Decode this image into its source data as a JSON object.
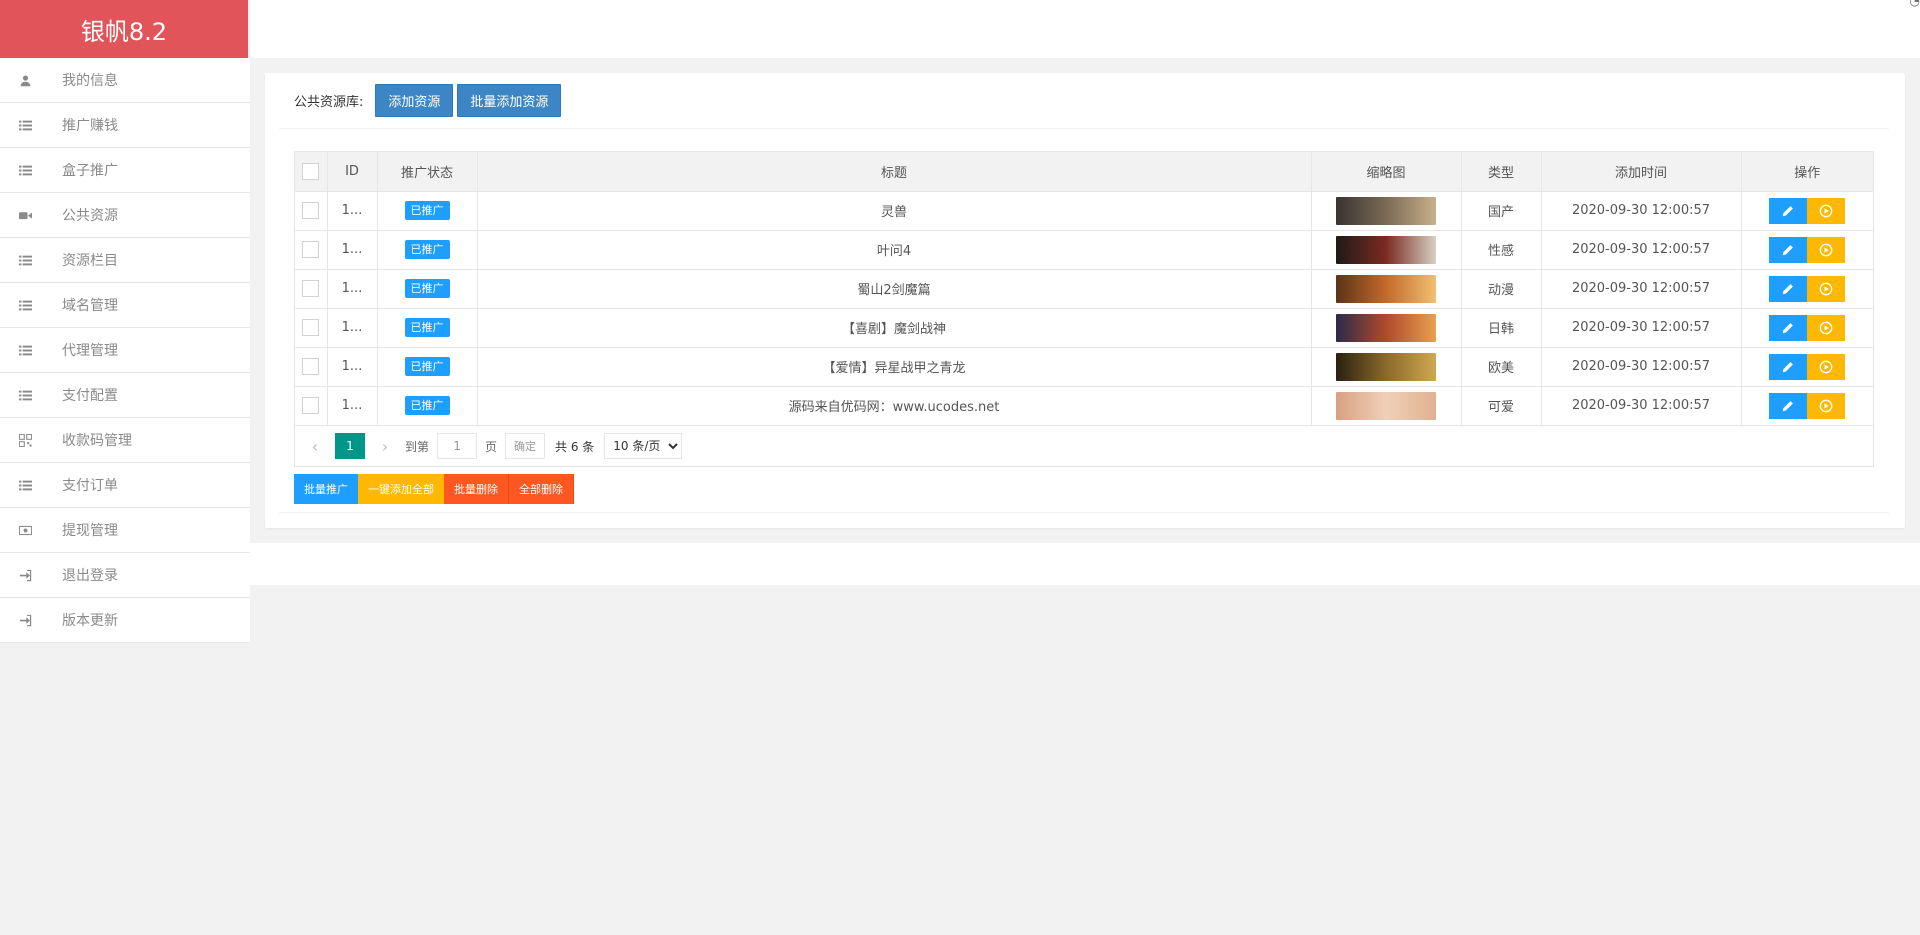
{
  "brand": {
    "title": "银帆8.2"
  },
  "sidebar": {
    "items": [
      {
        "label": "我的信息",
        "icon": "user-icon"
      },
      {
        "label": "推广赚钱",
        "icon": "list-icon"
      },
      {
        "label": "盒子推广",
        "icon": "list-icon"
      },
      {
        "label": "公共资源",
        "icon": "video-icon"
      },
      {
        "label": "资源栏目",
        "icon": "list-icon"
      },
      {
        "label": "域名管理",
        "icon": "list-icon"
      },
      {
        "label": "代理管理",
        "icon": "list-icon"
      },
      {
        "label": "支付配置",
        "icon": "list-icon"
      },
      {
        "label": "收款码管理",
        "icon": "qrcode-icon"
      },
      {
        "label": "支付订单",
        "icon": "list-icon"
      },
      {
        "label": "提现管理",
        "icon": "money-icon"
      },
      {
        "label": "退出登录",
        "icon": "sign-in-icon"
      },
      {
        "label": "版本更新",
        "icon": "sign-in-icon"
      }
    ]
  },
  "toolbar": {
    "label": "公共资源库:",
    "add_button": "添加资源",
    "batch_add_button": "批量添加资源"
  },
  "table": {
    "headers": {
      "id": "ID",
      "status": "推广状态",
      "title": "标题",
      "thumb": "缩略图",
      "type": "类型",
      "time": "添加时间",
      "ops": "操作"
    },
    "rows": [
      {
        "id": "1...",
        "status": "已推广",
        "title": "灵兽",
        "type": "国产",
        "time": "2020-09-30 12:00:57"
      },
      {
        "id": "1...",
        "status": "已推广",
        "title": "叶问4",
        "type": "性感",
        "time": "2020-09-30 12:00:57"
      },
      {
        "id": "1...",
        "status": "已推广",
        "title": "蜀山2剑魔篇",
        "type": "动漫",
        "time": "2020-09-30 12:00:57"
      },
      {
        "id": "1...",
        "status": "已推广",
        "title": "【喜剧】魔剑战神",
        "type": "日韩",
        "time": "2020-09-30 12:00:57"
      },
      {
        "id": "1...",
        "status": "已推广",
        "title": "【爱情】异星战甲之青龙",
        "type": "欧美",
        "time": "2020-09-30 12:00:57"
      },
      {
        "id": "1...",
        "status": "已推广",
        "title": "源码来自优码网：www.ucodes.net",
        "type": "可爱",
        "time": "2020-09-30 12:00:57"
      }
    ],
    "thumb_colors": [
      [
        "#3a3430",
        "#7a6a55",
        "#c8b08a"
      ],
      [
        "#1d1a18",
        "#7b2b22",
        "#d8d0c4"
      ],
      [
        "#5a3318",
        "#c46a2a",
        "#f0c070"
      ],
      [
        "#2a2a4a",
        "#b04a2a",
        "#e8a050"
      ],
      [
        "#2a2010",
        "#8a6a2a",
        "#d0a850"
      ],
      [
        "#d8a080",
        "#f0d0b8",
        "#e0b090"
      ]
    ]
  },
  "pager": {
    "current_page": "1",
    "goto_label": "到第",
    "goto_value": "1",
    "page_unit": "页",
    "confirm": "确定",
    "total": "共 6 条",
    "page_size": "10 条/页"
  },
  "bottom_buttons": {
    "batch_promote": "批量推广",
    "add_all": "一键添加全部",
    "batch_delete": "批量删除",
    "delete_all": "全部删除"
  },
  "colors": {
    "brand_red": "#e0545a",
    "primary_blue": "#1e9fff",
    "warn_yellow": "#ffb800",
    "danger_orange": "#ff5722",
    "pager_green": "#009688"
  }
}
